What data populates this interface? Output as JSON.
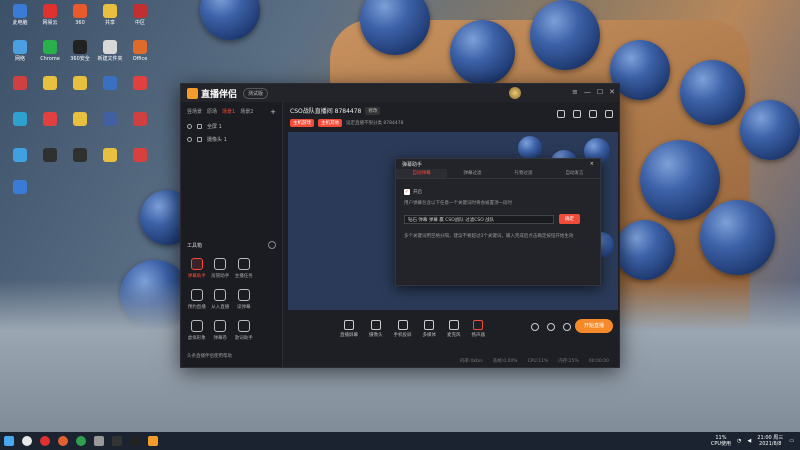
{
  "app": {
    "name": "直播伴侣",
    "version_badge": "测试版",
    "minimize": "—",
    "maximize": "☐",
    "close": "✕"
  },
  "sidebar": {
    "scene_tabs": [
      "竖场景",
      "原场",
      "场景1",
      "场景2"
    ],
    "add": "+",
    "layers": [
      "全屏 1",
      "摄像头 1"
    ],
    "toolbox_title": "工具箱",
    "tools": [
      {
        "label": "弹幕助手",
        "icon": "barrage-icon"
      },
      {
        "label": "房管助手",
        "icon": "admin-icon"
      },
      {
        "label": "主播任务",
        "icon": "task-icon"
      },
      {
        "label": "",
        "icon": "placeholder-icon"
      },
      {
        "label": "预约直播",
        "icon": "schedule-icon"
      },
      {
        "label": "从入直播",
        "icon": "enter-icon"
      },
      {
        "label": "读弹幕",
        "icon": "read-icon"
      },
      {
        "label": "",
        "icon": "placeholder-icon"
      },
      {
        "label": "虚拟形象",
        "icon": "avatar-icon"
      },
      {
        "label": "弹幕卷",
        "icon": "scroll-icon"
      },
      {
        "label": "歌词助手",
        "icon": "lyrics-icon"
      },
      {
        "label": "",
        "icon": "placeholder-icon"
      }
    ],
    "footer": "头条直播伴侣使用帮助"
  },
  "room": {
    "title": "CSO战队直播间 8784478",
    "tag": "修改",
    "chips": [
      "主机游戏",
      "主机其他"
    ],
    "sub_text": "设定直播不限分类 8784478"
  },
  "modal": {
    "title": "弹幕助手",
    "close": "×",
    "tabs": [
      "自动弹幕",
      "弹幕过滤",
      "礼物过滤",
      "自动发言"
    ],
    "enable_label": "开启",
    "description": "用户弹幕包含以下任意一个关键词时将会被置顶一段时",
    "input_value": "钻石 弹幕 弹幕 赢 CSO战队 过滤CSO 战队",
    "confirm": "确定",
    "hint": "多个关键词用空格分隔，建议不要超过3个关键词，输入完成后点击确定按钮开始生效"
  },
  "controls": [
    {
      "label": "直播屏幕",
      "icon": "screen-icon"
    },
    {
      "label": "摄像头",
      "icon": "camera-icon"
    },
    {
      "label": "手机投屏",
      "icon": "phone-cast-icon"
    },
    {
      "label": "多媒体",
      "icon": "media-icon"
    },
    {
      "label": "麦克风",
      "icon": "mic-icon"
    },
    {
      "label": "扬声器",
      "icon": "speaker-icon"
    }
  ],
  "live_button": "开始直播",
  "status": [
    "码率:0kb/s",
    "丢帧:0.00%",
    "CPU:11%",
    "内存:25%",
    "00:00:00"
  ],
  "taskbar": {
    "cpu": "11%",
    "cpu_label": "CPU使用",
    "time": "21:00 周三",
    "date": "2021/8/8"
  },
  "desktop_icons": [
    {
      "label": "此电脑"
    },
    {
      "label": "网易云"
    },
    {
      "label": "360"
    },
    {
      "label": "共享"
    },
    {
      "label": "中区"
    },
    {
      "label": "网络"
    },
    {
      "label": "Chrome"
    },
    {
      "label": "360安全"
    },
    {
      "label": "新建文件夹"
    },
    {
      "label": "Office"
    }
  ]
}
